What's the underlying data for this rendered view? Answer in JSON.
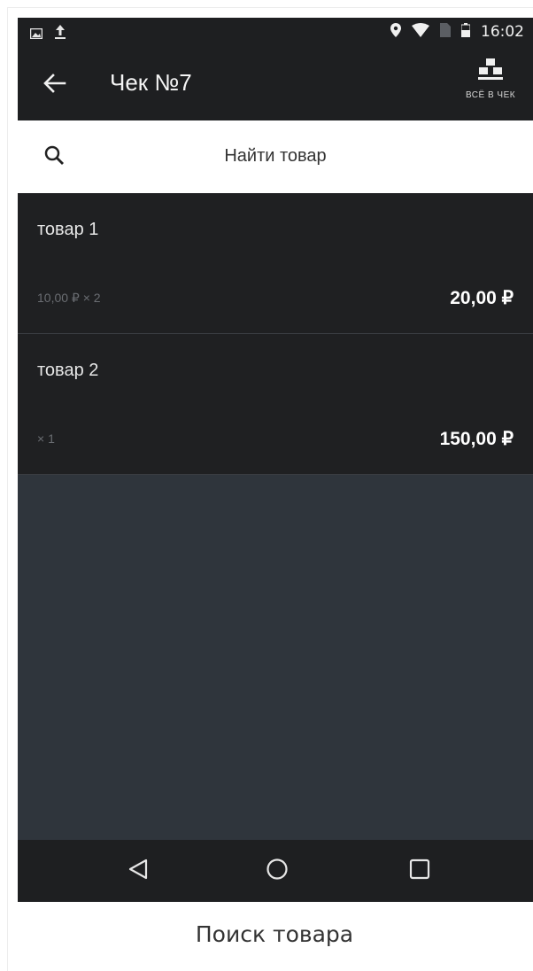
{
  "status_bar": {
    "time": "16:02",
    "icons": [
      "image-icon",
      "upload-icon",
      "location-icon",
      "wifi-icon",
      "no-sim-icon",
      "battery-icon"
    ]
  },
  "toolbar": {
    "title": "Чек №7",
    "action_label": "ВСЁ В ЧЕК"
  },
  "search": {
    "placeholder": "Найти товар"
  },
  "items": [
    {
      "name": "товар 1",
      "qty": "10,00 ₽ × 2",
      "sum": "20,00 ₽"
    },
    {
      "name": "товар 2",
      "qty": "× 1",
      "sum": "150,00 ₽"
    }
  ],
  "caption": "Поиск товара",
  "colors": {
    "bar": "#1e1f21",
    "item_bg": "#1f2022",
    "empty_bg": "#2f353c"
  }
}
